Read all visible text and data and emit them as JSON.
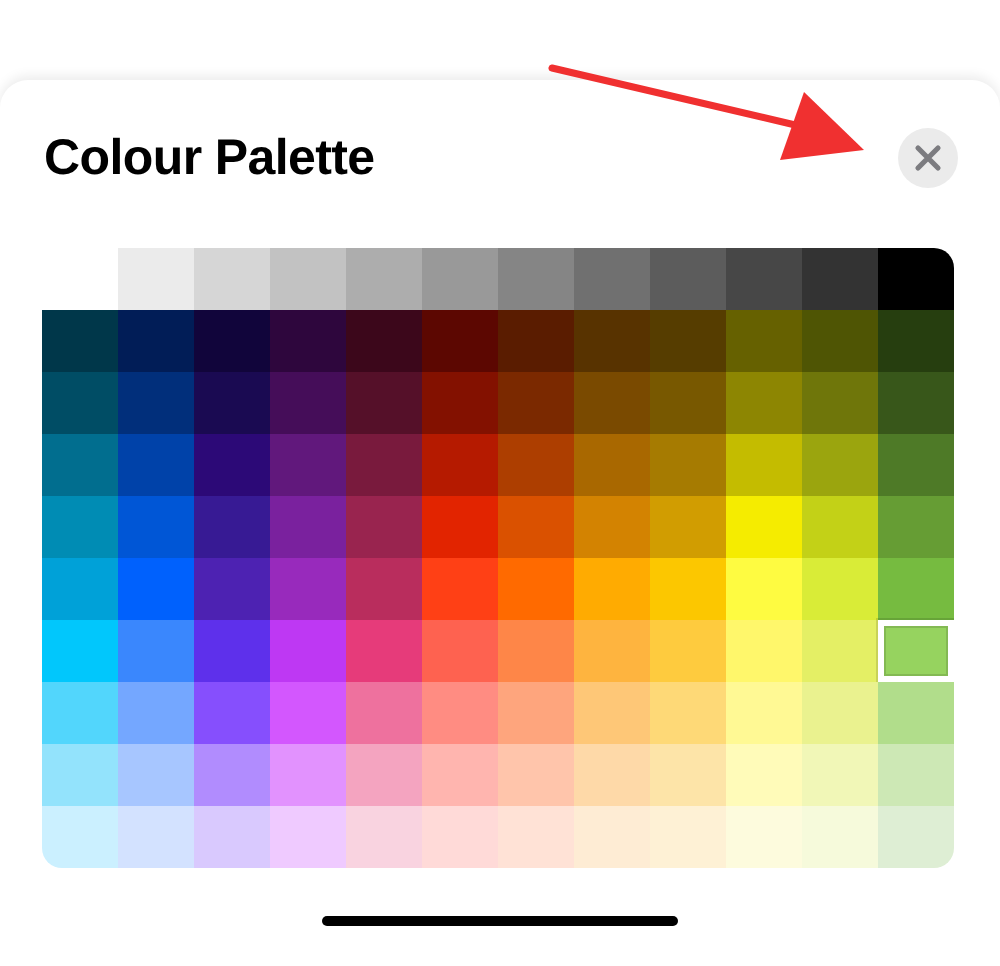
{
  "sheet": {
    "title": "Colour Palette"
  },
  "palette": {
    "rows": [
      {
        "swatches": [
          {
            "color": "#ebebeb",
            "selected": false
          },
          {
            "color": "#d6d6d6",
            "selected": false
          },
          {
            "color": "#c2c2c2",
            "selected": false
          },
          {
            "color": "#adadad",
            "selected": false
          },
          {
            "color": "#999999",
            "selected": false
          },
          {
            "color": "#858585",
            "selected": false
          },
          {
            "color": "#707070",
            "selected": false
          },
          {
            "color": "#5c5c5c",
            "selected": false
          },
          {
            "color": "#474747",
            "selected": false
          },
          {
            "color": "#333333",
            "selected": false
          },
          {
            "color": "#000000",
            "selected": false
          }
        ]
      },
      {
        "swatches": [
          {
            "color": "#00374a",
            "selected": false
          },
          {
            "color": "#011d57",
            "selected": false
          },
          {
            "color": "#11053b",
            "selected": false
          },
          {
            "color": "#2e063d",
            "selected": false
          },
          {
            "color": "#3c071b",
            "selected": false
          },
          {
            "color": "#5c0701",
            "selected": false
          },
          {
            "color": "#5a1c00",
            "selected": false
          },
          {
            "color": "#583300",
            "selected": false
          },
          {
            "color": "#563d00",
            "selected": false
          },
          {
            "color": "#666100",
            "selected": false
          },
          {
            "color": "#4f5504",
            "selected": false
          },
          {
            "color": "#263e0f",
            "selected": false
          }
        ]
      },
      {
        "swatches": [
          {
            "color": "#004d65",
            "selected": false
          },
          {
            "color": "#012f7b",
            "selected": false
          },
          {
            "color": "#1a0a52",
            "selected": false
          },
          {
            "color": "#450d59",
            "selected": false
          },
          {
            "color": "#551029",
            "selected": false
          },
          {
            "color": "#831100",
            "selected": false
          },
          {
            "color": "#7b2900",
            "selected": false
          },
          {
            "color": "#7a4a00",
            "selected": false
          },
          {
            "color": "#785800",
            "selected": false
          },
          {
            "color": "#8d8602",
            "selected": false
          },
          {
            "color": "#6f760a",
            "selected": false
          },
          {
            "color": "#38571a",
            "selected": false
          }
        ]
      },
      {
        "swatches": [
          {
            "color": "#016e8f",
            "selected": false
          },
          {
            "color": "#0042a9",
            "selected": false
          },
          {
            "color": "#2c0977",
            "selected": false
          },
          {
            "color": "#61187c",
            "selected": false
          },
          {
            "color": "#791a3d",
            "selected": false
          },
          {
            "color": "#b51a00",
            "selected": false
          },
          {
            "color": "#ad3e00",
            "selected": false
          },
          {
            "color": "#a96800",
            "selected": false
          },
          {
            "color": "#a67b01",
            "selected": false
          },
          {
            "color": "#c4bc00",
            "selected": false
          },
          {
            "color": "#9ba50e",
            "selected": false
          },
          {
            "color": "#4e7a27",
            "selected": false
          }
        ]
      },
      {
        "swatches": [
          {
            "color": "#008cb4",
            "selected": false
          },
          {
            "color": "#0056d6",
            "selected": false
          },
          {
            "color": "#371a94",
            "selected": false
          },
          {
            "color": "#7a219e",
            "selected": false
          },
          {
            "color": "#99244f",
            "selected": false
          },
          {
            "color": "#e22400",
            "selected": false
          },
          {
            "color": "#da5100",
            "selected": false
          },
          {
            "color": "#d38301",
            "selected": false
          },
          {
            "color": "#d19d01",
            "selected": false
          },
          {
            "color": "#f5ec00",
            "selected": false
          },
          {
            "color": "#c3d117",
            "selected": false
          },
          {
            "color": "#669d34",
            "selected": false
          }
        ]
      },
      {
        "swatches": [
          {
            "color": "#00a1d8",
            "selected": false
          },
          {
            "color": "#0061fd",
            "selected": false
          },
          {
            "color": "#4d22b2",
            "selected": false
          },
          {
            "color": "#982abc",
            "selected": false
          },
          {
            "color": "#b92d5d",
            "selected": false
          },
          {
            "color": "#ff4015",
            "selected": false
          },
          {
            "color": "#ff6a00",
            "selected": false
          },
          {
            "color": "#ffab01",
            "selected": false
          },
          {
            "color": "#fcc700",
            "selected": false
          },
          {
            "color": "#fefb41",
            "selected": false
          },
          {
            "color": "#d9ec37",
            "selected": false
          },
          {
            "color": "#76bb40",
            "selected": false
          }
        ]
      },
      {
        "swatches": [
          {
            "color": "#01c7fc",
            "selected": false
          },
          {
            "color": "#3a87fd",
            "selected": false
          },
          {
            "color": "#5e30eb",
            "selected": false
          },
          {
            "color": "#be38f3",
            "selected": false
          },
          {
            "color": "#e63b7a",
            "selected": false
          },
          {
            "color": "#fe6250",
            "selected": false
          },
          {
            "color": "#fe8648",
            "selected": false
          },
          {
            "color": "#feb43f",
            "selected": false
          },
          {
            "color": "#fecb3e",
            "selected": false
          },
          {
            "color": "#fff76b",
            "selected": false
          },
          {
            "color": "#e4ef65",
            "selected": false
          },
          {
            "color": "#96d35f",
            "selected": true
          }
        ]
      },
      {
        "swatches": [
          {
            "color": "#52d6fc",
            "selected": false
          },
          {
            "color": "#74a7ff",
            "selected": false
          },
          {
            "color": "#864ffd",
            "selected": false
          },
          {
            "color": "#d357fe",
            "selected": false
          },
          {
            "color": "#ee719e",
            "selected": false
          },
          {
            "color": "#ff8c82",
            "selected": false
          },
          {
            "color": "#fea57d",
            "selected": false
          },
          {
            "color": "#fec777",
            "selected": false
          },
          {
            "color": "#fed977",
            "selected": false
          },
          {
            "color": "#fff994",
            "selected": false
          },
          {
            "color": "#eaf28f",
            "selected": false
          },
          {
            "color": "#b1dd8b",
            "selected": false
          }
        ]
      },
      {
        "swatches": [
          {
            "color": "#93e3fc",
            "selected": false
          },
          {
            "color": "#a7c6ff",
            "selected": false
          },
          {
            "color": "#b18cfe",
            "selected": false
          },
          {
            "color": "#e292fe",
            "selected": false
          },
          {
            "color": "#f4a4c0",
            "selected": false
          },
          {
            "color": "#ffb5af",
            "selected": false
          },
          {
            "color": "#ffc5ab",
            "selected": false
          },
          {
            "color": "#fed9a8",
            "selected": false
          },
          {
            "color": "#fde4a8",
            "selected": false
          },
          {
            "color": "#fffbb9",
            "selected": false
          },
          {
            "color": "#f1f7b7",
            "selected": false
          },
          {
            "color": "#cde8b5",
            "selected": false
          }
        ]
      },
      {
        "swatches": [
          {
            "color": "#cbf0ff",
            "selected": false
          },
          {
            "color": "#d3e2ff",
            "selected": false
          },
          {
            "color": "#d9c9fe",
            "selected": false
          },
          {
            "color": "#efcaff",
            "selected": false
          },
          {
            "color": "#f9d3e0",
            "selected": false
          },
          {
            "color": "#ffdad8",
            "selected": false
          },
          {
            "color": "#ffe2d6",
            "selected": false
          },
          {
            "color": "#feecd4",
            "selected": false
          },
          {
            "color": "#fef1d5",
            "selected": false
          },
          {
            "color": "#fdfbdd",
            "selected": false
          },
          {
            "color": "#f6fadb",
            "selected": false
          },
          {
            "color": "#deeed4",
            "selected": false
          }
        ]
      }
    ]
  }
}
